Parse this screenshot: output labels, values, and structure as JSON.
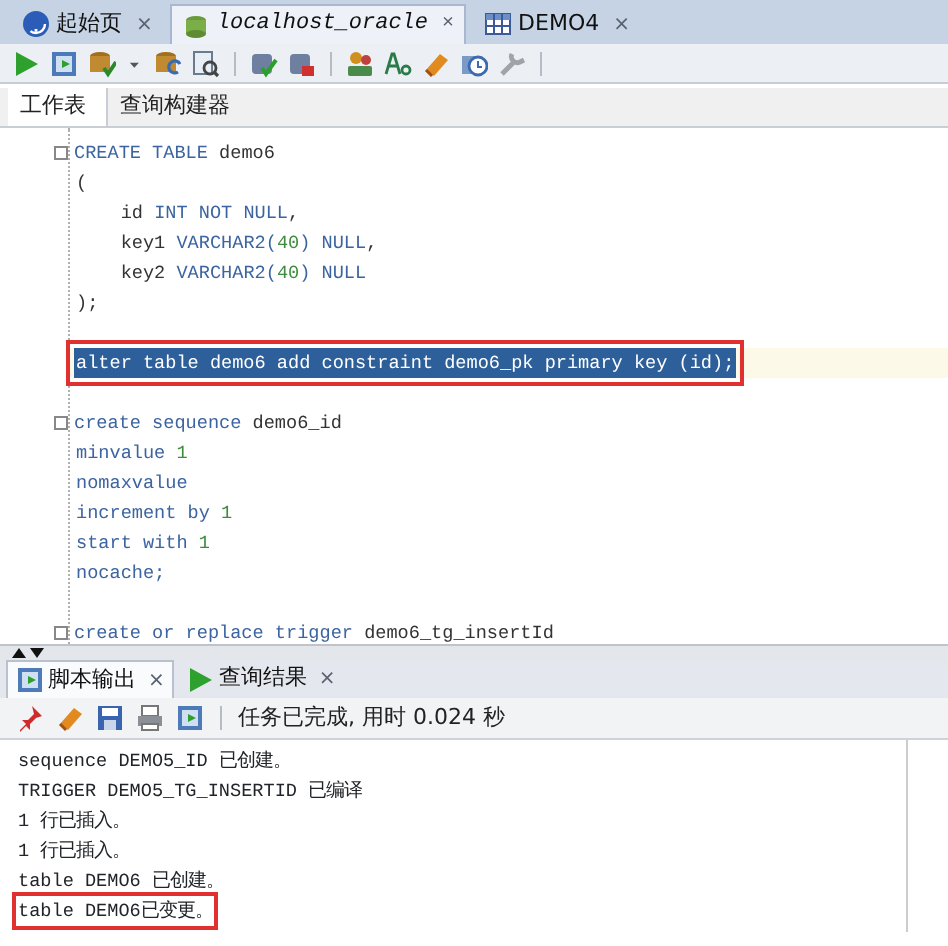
{
  "doc_tabs": [
    {
      "label": "起始页",
      "kind": "help",
      "selected": false,
      "italic": false,
      "close": "×"
    },
    {
      "label": "localhost_oracle",
      "kind": "connection",
      "selected": true,
      "italic": true,
      "close": "×"
    },
    {
      "label": "DEMO4",
      "kind": "table",
      "selected": false,
      "italic": false,
      "close": "×"
    }
  ],
  "toolbar": [
    {
      "kind": "run"
    },
    {
      "kind": "script"
    },
    {
      "kind": "commit"
    },
    {
      "kind": "caret"
    },
    {
      "kind": "rollback"
    },
    {
      "kind": "explain"
    },
    {
      "kind": "sep"
    },
    {
      "kind": "check"
    },
    {
      "kind": "cancel"
    },
    {
      "kind": "sep"
    },
    {
      "kind": "dba"
    },
    {
      "kind": "case"
    },
    {
      "kind": "eraser"
    },
    {
      "kind": "history"
    },
    {
      "kind": "tools"
    },
    {
      "kind": "sep"
    }
  ],
  "editor_tabs": [
    {
      "label": "工作表",
      "selected": true
    },
    {
      "label": "查询构建器",
      "selected": false
    }
  ],
  "code_lines": [
    {
      "kind": "code",
      "fold": true,
      "selected": false,
      "boxed": false,
      "segments": [
        {
          "t": "CREATE TABLE",
          "kind": "kw"
        },
        {
          "t": " demo6",
          "kind": "id"
        }
      ]
    },
    {
      "kind": "code",
      "fold": false,
      "selected": false,
      "boxed": false,
      "segments": [
        {
          "t": "(",
          "kind": "id"
        }
      ]
    },
    {
      "kind": "code",
      "fold": false,
      "selected": false,
      "boxed": false,
      "segments": [
        {
          "t": "    id",
          "kind": "id"
        },
        {
          "t": " INT NOT NULL",
          "kind": "kw"
        },
        {
          "t": ",",
          "kind": "id"
        }
      ]
    },
    {
      "kind": "code",
      "fold": false,
      "selected": false,
      "boxed": false,
      "segments": [
        {
          "t": "    key1",
          "kind": "id"
        },
        {
          "t": " VARCHAR2(",
          "kind": "kw"
        },
        {
          "t": "40",
          "kind": "num"
        },
        {
          "t": ") NULL",
          "kind": "kw"
        },
        {
          "t": ",",
          "kind": "id"
        }
      ]
    },
    {
      "kind": "code",
      "fold": false,
      "selected": false,
      "boxed": false,
      "segments": [
        {
          "t": "    key2",
          "kind": "id"
        },
        {
          "t": " VARCHAR2(",
          "kind": "kw"
        },
        {
          "t": "40",
          "kind": "num"
        },
        {
          "t": ") NULL",
          "kind": "kw"
        }
      ]
    },
    {
      "kind": "code",
      "fold": false,
      "selected": false,
      "boxed": false,
      "segments": [
        {
          "t": ");",
          "kind": "id"
        }
      ]
    },
    {
      "kind": "blank"
    },
    {
      "kind": "code",
      "fold": false,
      "selected": true,
      "boxed": true,
      "segments": [
        {
          "t": "alter table demo6 add constraint demo6_pk primary key (id);"
        }
      ]
    },
    {
      "kind": "blank"
    },
    {
      "kind": "code",
      "fold": true,
      "selected": false,
      "boxed": false,
      "segments": [
        {
          "t": "create sequence",
          "kind": "kw"
        },
        {
          "t": " demo6_id",
          "kind": "id"
        }
      ]
    },
    {
      "kind": "code",
      "fold": false,
      "selected": false,
      "boxed": false,
      "segments": [
        {
          "t": "minvalue ",
          "kind": "kw"
        },
        {
          "t": "1",
          "kind": "num"
        }
      ]
    },
    {
      "kind": "code",
      "fold": false,
      "selected": false,
      "boxed": false,
      "segments": [
        {
          "t": "nomaxvalue",
          "kind": "kw"
        }
      ]
    },
    {
      "kind": "code",
      "fold": false,
      "selected": false,
      "boxed": false,
      "segments": [
        {
          "t": "increment by ",
          "kind": "kw"
        },
        {
          "t": "1",
          "kind": "num"
        }
      ]
    },
    {
      "kind": "code",
      "fold": false,
      "selected": false,
      "boxed": false,
      "segments": [
        {
          "t": "start with ",
          "kind": "kw"
        },
        {
          "t": "1",
          "kind": "num"
        }
      ]
    },
    {
      "kind": "code",
      "fold": false,
      "selected": false,
      "boxed": false,
      "segments": [
        {
          "t": "nocache;",
          "kind": "kw"
        }
      ]
    },
    {
      "kind": "blank"
    },
    {
      "kind": "code",
      "fold": true,
      "selected": false,
      "boxed": false,
      "segments": [
        {
          "t": "create or replace trigger",
          "kind": "kw"
        },
        {
          "t": " demo6_tg_insertId",
          "kind": "id"
        }
      ]
    }
  ],
  "output_tabs": [
    {
      "label": "脚本输出",
      "kind": "script",
      "selected": true,
      "close": "×"
    },
    {
      "label": "查询结果",
      "kind": "run",
      "selected": false,
      "close": "×"
    }
  ],
  "output_toolbar": [
    {
      "kind": "pin"
    },
    {
      "kind": "eraser"
    },
    {
      "kind": "save"
    },
    {
      "kind": "print"
    },
    {
      "kind": "script"
    },
    {
      "kind": "sep"
    }
  ],
  "status": "任务已完成, 用时 0.024 秒",
  "output_lines": [
    {
      "text": "sequence DEMO5_ID 已创建。",
      "boxed": false
    },
    {
      "text": "TRIGGER DEMO5_TG_INSERTID 已编译",
      "boxed": false
    },
    {
      "text": "1 行已插入。",
      "boxed": false
    },
    {
      "text": "1 行已插入。",
      "boxed": false
    },
    {
      "text": "table DEMO6 已创建。",
      "boxed": false
    },
    {
      "text": "table DEMO6已变更。",
      "boxed": true
    }
  ]
}
